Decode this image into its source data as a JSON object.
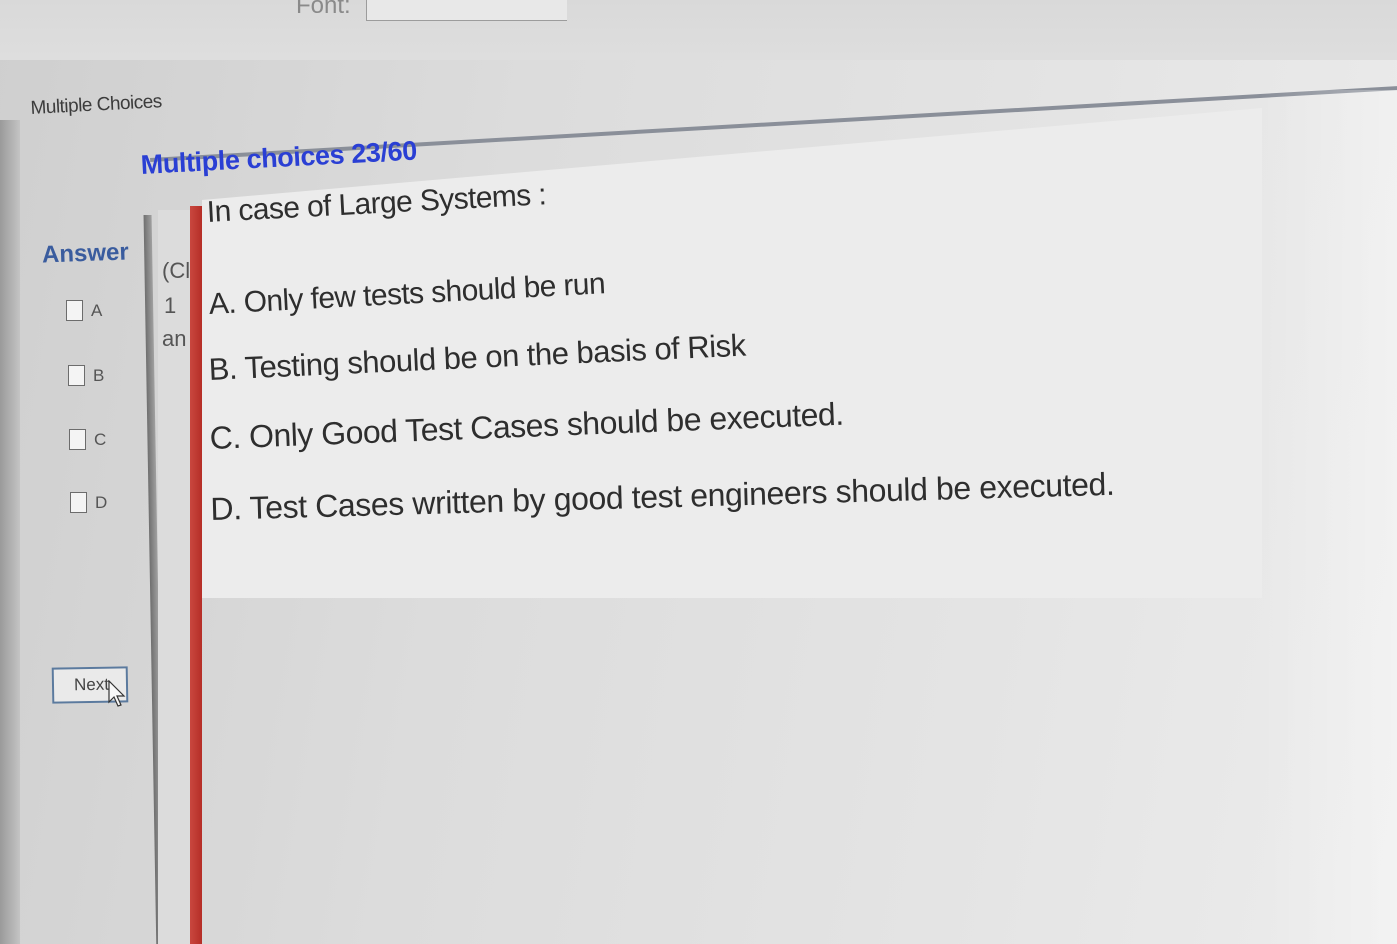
{
  "toolbar": {
    "font_label": "Font:",
    "font_value": ""
  },
  "tab": {
    "label": "Multiple Choices"
  },
  "panel": {
    "title": "Multiple choices 23/60"
  },
  "answer": {
    "label": "Answer",
    "options": [
      "A",
      "B",
      "C",
      "D"
    ]
  },
  "middle_column": {
    "line1": "(Cl",
    "line2": "1",
    "line3": "an"
  },
  "question": {
    "text": "In case of Large Systems :",
    "choices": [
      "A.  Only few tests should be run",
      "B.  Testing should be on the basis of Risk",
      "C.  Only Good Test Cases should be executed.",
      "D.  Test Cases written by good test engineers should be executed."
    ]
  },
  "buttons": {
    "next_label": "Next"
  },
  "colors": {
    "title_blue": "#2a3fd4",
    "answer_label": "#3a5c9e",
    "red_divider": "#b52e27"
  }
}
